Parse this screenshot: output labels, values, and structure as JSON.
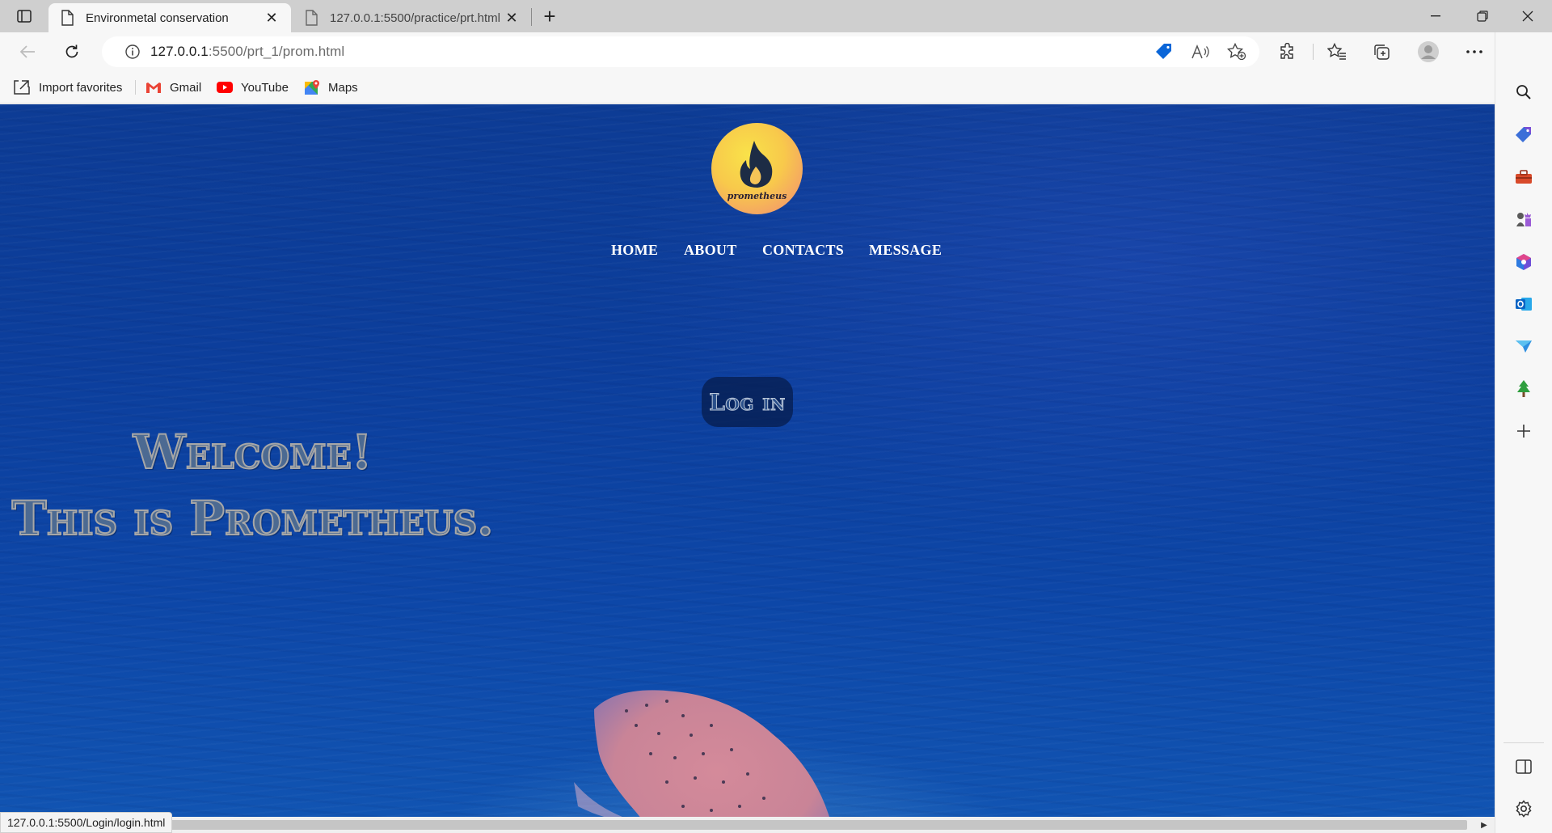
{
  "browser": {
    "tabs": [
      {
        "title": "Environmetal conservation",
        "active": true
      },
      {
        "title": "127.0.0.1:5500/practice/prt.html",
        "active": false
      }
    ],
    "address": {
      "host": "127.0.0.1",
      "rest": ":5500/prt_1/prom.html"
    },
    "favorites": [
      {
        "label": "Import favorites",
        "icon": "import-icon"
      },
      {
        "label": "Gmail",
        "icon": "gmail-icon"
      },
      {
        "label": "YouTube",
        "icon": "youtube-icon"
      },
      {
        "label": "Maps",
        "icon": "maps-icon"
      }
    ],
    "status_url": "127.0.0.1:5500/Login/login.html",
    "sidebar_icons": [
      "search-icon",
      "tag-icon",
      "toolbox-icon",
      "games-icon",
      "office-icon",
      "outlook-icon",
      "send-icon",
      "tree-icon",
      "add-icon",
      "panel-icon",
      "settings-icon"
    ]
  },
  "page": {
    "logo_text": "prometheus",
    "nav": [
      "HOME",
      "ABOUT",
      "CONTACTS",
      "MESSAGE"
    ],
    "login_label": "Log in",
    "welcome_line1": "Welcome!",
    "welcome_line2": "This is Prometheus."
  },
  "colors": {
    "ocean": "#0c3e9c",
    "logo_gradient_start": "#f9e24a",
    "logo_gradient_end": "#ef8a78",
    "edge_blue": "#0a66d8"
  }
}
